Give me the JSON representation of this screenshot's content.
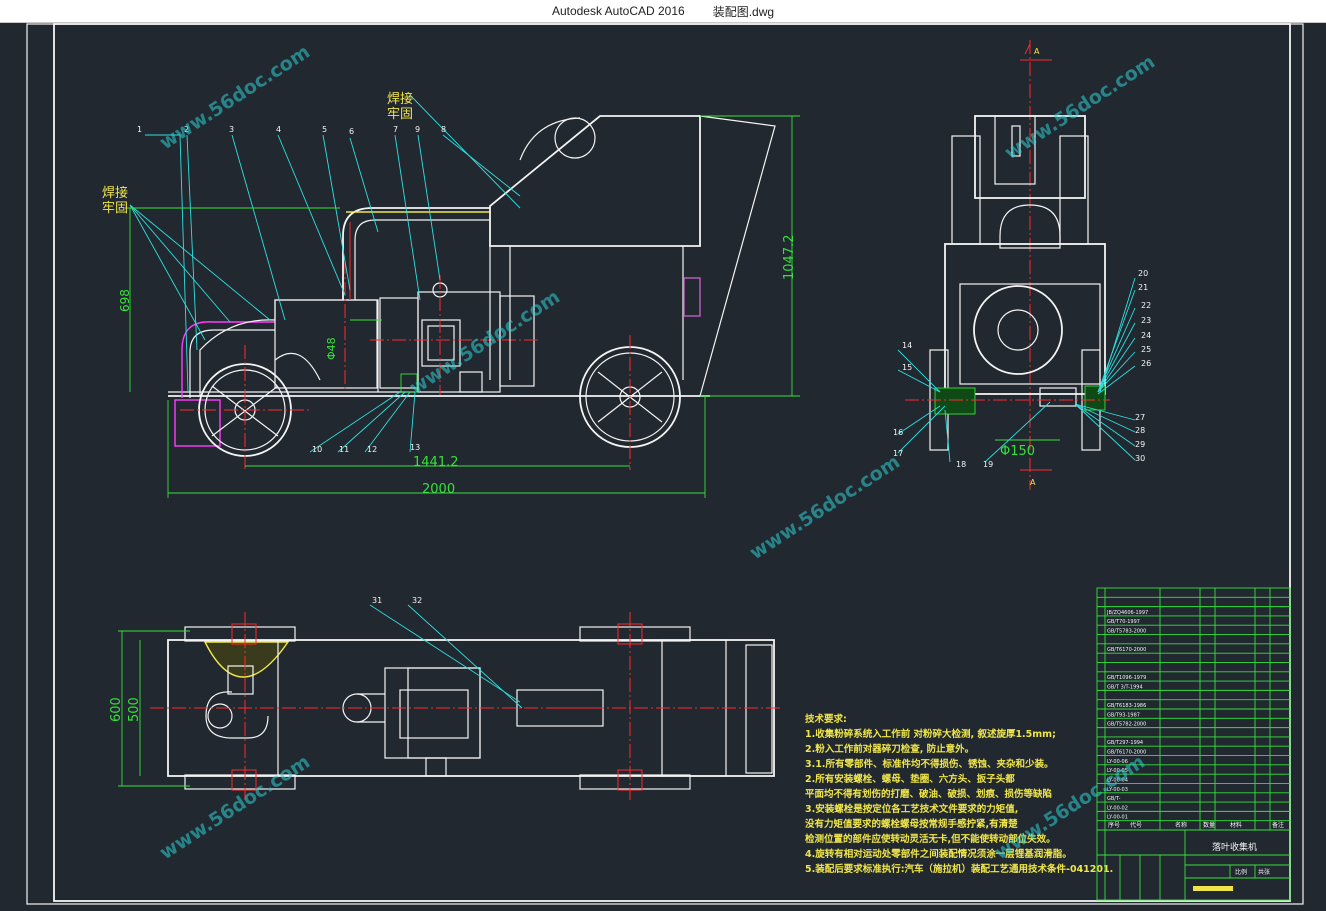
{
  "window": {
    "app_title": "Autodesk AutoCAD 2016",
    "file_name": "装配图.dwg"
  },
  "drawing": {
    "weld_note_1": [
      "焊接",
      "牢固"
    ],
    "weld_note_2": [
      "焊接",
      "牢固"
    ],
    "dimensions": {
      "height_698": "698",
      "height_1047": "1047.2",
      "len_1441": "1441.2",
      "len_2000": "2000",
      "dia_48": "Φ48",
      "dia_150": "Φ150",
      "w_600": "600",
      "w_500": "500"
    },
    "part_labels_top": [
      "1",
      "2",
      "3",
      "4",
      "5",
      "6",
      "7",
      "9",
      "8"
    ],
    "part_labels_bottom": [
      "10",
      "11",
      "12",
      "13"
    ],
    "part_labels_side_right": [
      "20",
      "21",
      "22",
      "23",
      "24",
      "25",
      "26",
      "27",
      "28",
      "29",
      "30"
    ],
    "part_labels_side_left": [
      "14",
      "15",
      "16",
      "17",
      "18",
      "19"
    ],
    "part_labels_plan": [
      "31",
      "32"
    ],
    "section_marks": [
      "A",
      "A"
    ],
    "watermark": "www.56doc.com"
  },
  "tech_requirements": {
    "title": "技术要求:",
    "lines": [
      "1.收集粉碎系统入工作前 对粉碎大检测, 叙述旋厚1.5mm;",
      "2.粉入工作前对器碎刀检查, 防止意外。",
      "3.1.所有零部件、标准件均不得损伤、锈蚀、夹杂和少装。",
      "2.所有安装螺栓、螺母、垫圈、六方头、扳子头都",
      "   平面均不得有划伤的打磨、破油、破损、划痕、损伤等缺陷",
      "3.安装螺栓是按定位各工艺技术文件要求的力矩值,",
      "   没有力矩值要求的螺栓螺母按常规手感拧紧,有清楚",
      "   检测位置的部件应使转动灵活无卡,但不能使转动部位失效。",
      "4.旋转有相对运动处零部件之间装配情况须涂一层锂基润滑脂。",
      "5.装配后要求标准执行:汽车（施拉机）装配工艺通用技术条件-041201."
    ]
  },
  "title_block": {
    "drawing_name": "落叶收集机",
    "scale_label": "比例",
    "sheet_label": "共张",
    "col_headers": [
      "序号",
      "代号",
      "名称",
      "数量",
      "材料",
      "备注"
    ],
    "row_codes": [
      "",
      "",
      "JB/ZQ4606-1997",
      "GB/T70-1997",
      "GB/T5783-2000",
      "",
      "GB/T6170-2000",
      "",
      "",
      "GB/T1096-1979",
      "GB/T 3/T-1994",
      "",
      "GB/T6183-1986",
      "GB/T93-1987",
      "GB/T5782-2000",
      "",
      "GB/T297-1994",
      "GB/T6170-2000",
      "LY-00-06",
      "LY-00-05",
      "LY-00-04",
      "LY-00-03",
      "GB/T-",
      "LY-00-02",
      "LY-00-01"
    ]
  },
  "colors": {
    "background": "#212830",
    "outline": "#f4f4f4",
    "centerline": "#ff2a2a",
    "leader": "#2fe0e0",
    "dimension": "#35e23a",
    "highlight": "#f0e64a",
    "magenta": "#ff3cff"
  }
}
